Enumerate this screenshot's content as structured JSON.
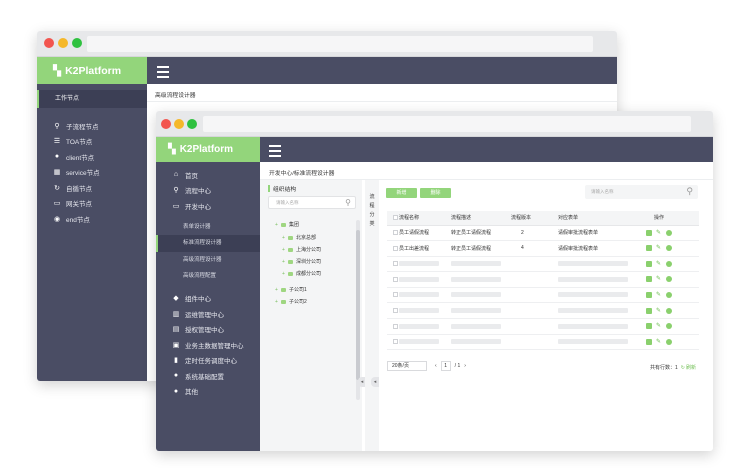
{
  "back_window": {
    "app_name": "K2Platform",
    "breadcrumb": "高级流程设计器",
    "sidebar": {
      "header": "工作节点",
      "items": [
        {
          "icon": "sitemap-icon",
          "label": "子流程节点"
        },
        {
          "icon": "list-icon",
          "label": "TOA节点"
        },
        {
          "icon": "user-icon",
          "label": "client节点"
        },
        {
          "icon": "grid-icon",
          "label": "service节点"
        },
        {
          "icon": "loop-icon",
          "label": "自循节点"
        },
        {
          "icon": "gateway-icon",
          "label": "网关节点"
        },
        {
          "icon": "end-icon",
          "label": "end节点"
        }
      ]
    }
  },
  "front_window": {
    "app_name": "K2Platform",
    "breadcrumb": "开发中心/标准流程设计器",
    "sidebar": {
      "items": [
        {
          "icon": "home-icon",
          "label": "首页"
        },
        {
          "icon": "process-center-icon",
          "label": "流程中心"
        },
        {
          "icon": "dev-center-icon",
          "label": "开发中心"
        }
      ],
      "subitems": [
        {
          "label": "表单设计器",
          "active": false
        },
        {
          "label": "标准流程设计器",
          "active": true
        },
        {
          "label": "高级流程设计器",
          "active": false
        },
        {
          "label": "高级流程配置",
          "active": false
        }
      ],
      "items2": [
        {
          "icon": "component-center-icon",
          "label": "组件中心"
        },
        {
          "icon": "ops-center-icon",
          "label": "运维管理中心"
        },
        {
          "icon": "auth-center-icon",
          "label": "授权管理中心"
        },
        {
          "icon": "masterdata-icon",
          "label": "业务主数据管理中心"
        },
        {
          "icon": "schedule-icon",
          "label": "定时任务调度中心"
        },
        {
          "icon": "system-config-icon",
          "label": "系统基础配置"
        },
        {
          "icon": "other-icon",
          "label": "其他"
        }
      ]
    },
    "org_tree": {
      "title": "组织结构",
      "search_placeholder": "请输入名称",
      "nodes": [
        {
          "label": "集团",
          "level": 0
        },
        {
          "label": "北京总部",
          "level": 1
        },
        {
          "label": "上海分公司",
          "level": 1
        },
        {
          "label": "深圳分公司",
          "level": 1
        },
        {
          "label": "成都分公司",
          "level": 1
        },
        {
          "label": "子公司1",
          "level": 0
        },
        {
          "label": "子公司2",
          "level": 0
        }
      ]
    },
    "vertical_tab": [
      "流",
      "程",
      "分",
      "类"
    ],
    "toolbar": {
      "add_label": "新增",
      "delete_label": "删除",
      "search_placeholder": "请输入名称"
    },
    "table": {
      "columns": [
        "流程名称",
        "流程描述",
        "流程版本",
        "对应表单",
        "操作"
      ],
      "rows": [
        {
          "name": "员工请假流程",
          "desc": "转正员工请假流程",
          "version": "2",
          "form": "请假审批流程表单"
        },
        {
          "name": "员工出差流程",
          "desc": "转正员工请假流程",
          "version": "4",
          "form": "请假审批流程表单"
        }
      ],
      "placeholder_rows": 6
    },
    "pager": {
      "page_size": "20条/页",
      "current_page": "1",
      "total_pages": "/ 1",
      "total_text": "共有行数：1",
      "refresh_label": "刷新"
    }
  }
}
